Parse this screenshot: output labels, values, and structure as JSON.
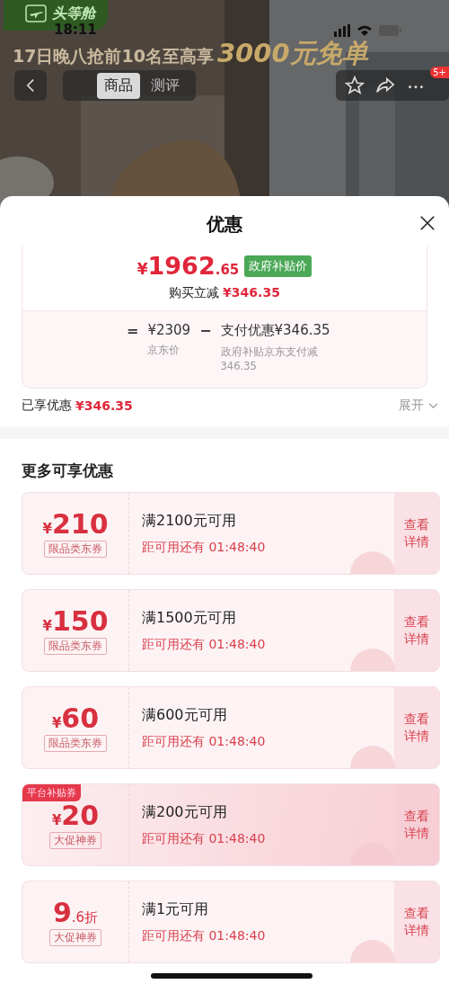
{
  "status_bar": {
    "time": "18:11"
  },
  "header": {
    "logo_text": "头等舱",
    "banner": {
      "lead": "17日晚八抢前10名至高享",
      "highlight": "3000元免单"
    },
    "tabs": [
      {
        "label": "商品",
        "selected": true
      },
      {
        "label": "测评",
        "selected": false
      }
    ],
    "cart_badge": "5+"
  },
  "sheet": {
    "title": "优惠",
    "price": {
      "currency": "¥",
      "integer": "1962",
      "decimal": ".65",
      "tag": "政府补贴价",
      "reduction_label": "购买立减",
      "reduction_value": "¥346.35"
    },
    "formula": {
      "equals": "=",
      "base_value": "¥2309",
      "base_label": "京东价",
      "minus": "−",
      "discount_value": "支付优惠¥346.35",
      "discount_label": "政府补贴京东支付减346.35"
    },
    "enjoyed": {
      "label": "已享优惠",
      "value": "¥346.35",
      "toggle": "展开"
    },
    "more_title": "更多可享优惠",
    "coupons": [
      {
        "kind": "cash",
        "symbol": "¥",
        "amount": "210",
        "type": "限品类东券",
        "condition": "满2100元可用",
        "countdown": "距可用还有 01:48:40",
        "action": "查看详情"
      },
      {
        "kind": "cash",
        "symbol": "¥",
        "amount": "150",
        "type": "限品类东券",
        "condition": "满1500元可用",
        "countdown": "距可用还有 01:48:40",
        "action": "查看详情"
      },
      {
        "kind": "cash",
        "symbol": "¥",
        "amount": "60",
        "type": "限品类东券",
        "condition": "满600元可用",
        "countdown": "距可用还有 01:48:40",
        "action": "查看详情"
      },
      {
        "kind": "cash",
        "symbol": "¥",
        "amount": "20",
        "type": "大促神券",
        "badge": "平台补贴券",
        "condition": "满200元可用",
        "countdown": "距可用还有 01:48:40",
        "action": "查看详情"
      },
      {
        "kind": "discount",
        "amount": "9",
        "fraction": ".6折",
        "type": "大促神券",
        "condition": "满1元可用",
        "countdown": "距可用还有 01:48:40",
        "action": "查看详情"
      }
    ]
  }
}
